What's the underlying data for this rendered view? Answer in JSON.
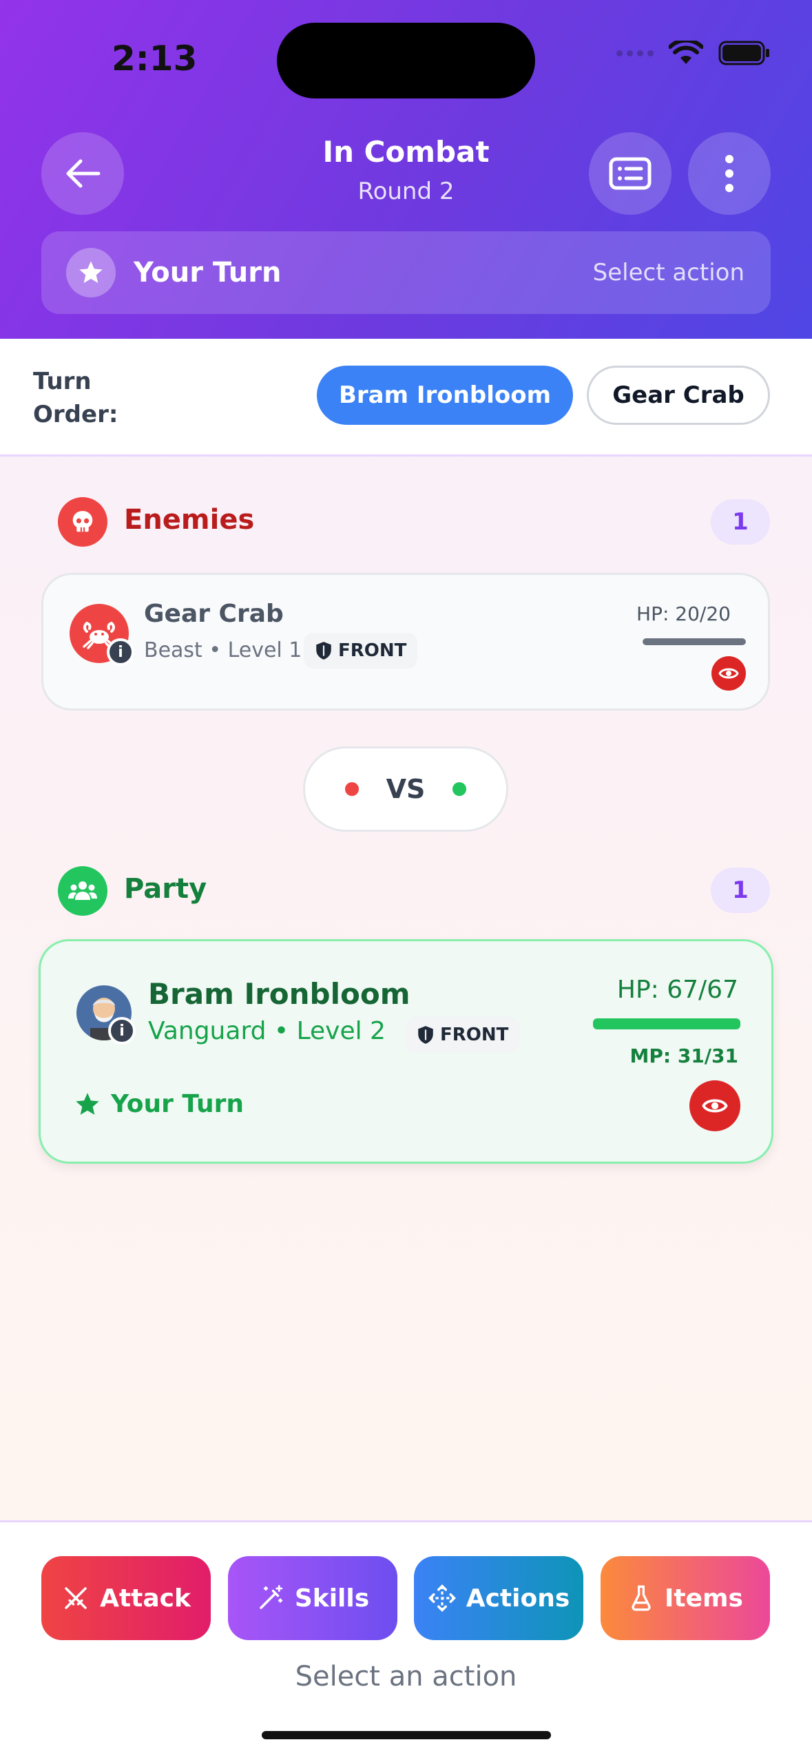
{
  "status_bar": {
    "time": "2:13"
  },
  "header": {
    "title": "In Combat",
    "subtitle": "Round 2",
    "back_icon": "arrow-left-icon",
    "log_icon": "list-card-icon",
    "menu_icon": "more-vertical-icon"
  },
  "turn_banner": {
    "label": "Your Turn",
    "hint": "Select action"
  },
  "turn_order": {
    "label": "Turn Order:",
    "chips": [
      {
        "label": "Bram Ironbloom",
        "active": true
      },
      {
        "label": "Gear Crab",
        "active": false
      }
    ]
  },
  "enemies": {
    "title": "Enemies",
    "count": "1",
    "cards": [
      {
        "name": "Gear Crab",
        "meta": "Beast • Level 1",
        "position": "FRONT",
        "hp_text": "HP: 20/20",
        "hp": 20,
        "hp_max": 20
      }
    ]
  },
  "vs": {
    "label": "VS"
  },
  "party": {
    "title": "Party",
    "count": "1",
    "cards": [
      {
        "name": "Bram Ironbloom",
        "meta": "Vanguard • Level 2",
        "position": "FRONT",
        "hp_text": "HP: 67/67",
        "hp": 67,
        "hp_max": 67,
        "mp_text": "MP: 31/31",
        "turn_text": "Your Turn"
      }
    ]
  },
  "actions": {
    "buttons": [
      {
        "label": "Attack",
        "icon": "crossed-swords-icon"
      },
      {
        "label": "Skills",
        "icon": "magic-wand-icon"
      },
      {
        "label": "Actions",
        "icon": "move-arrows-icon"
      },
      {
        "label": "Items",
        "icon": "flask-icon"
      }
    ],
    "hint": "Select an action"
  },
  "colors": {
    "header_start": "#9333ea",
    "header_end": "#4f46e5",
    "active_chip": "#3b82f6",
    "enemy_red": "#dc2626",
    "party_green": "#16a34a",
    "count_purple": "#7c3aed"
  }
}
